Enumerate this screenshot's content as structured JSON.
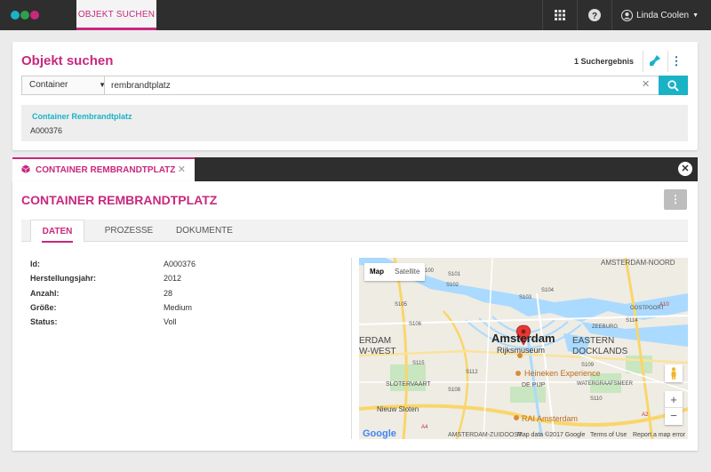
{
  "app": {
    "active_tab": "OBJEKT SUCHEN",
    "user_name": "Linda Coolen",
    "logo_colors": [
      "#1ab3c6",
      "#2f9e4f",
      "#c8287e"
    ]
  },
  "search": {
    "title": "Objekt suchen",
    "results_count": "1 Suchergebnis",
    "type_select": "Container",
    "query": "rembrandtplatz",
    "result": {
      "title": "Container Rembrandtplatz",
      "id": "A000376"
    }
  },
  "detail": {
    "tab_label": "CONTAINER REMBRANDTPLATZ",
    "heading": "CONTAINER REMBRANDTPLATZ",
    "tabs": [
      "DATEN",
      "PROZESSE",
      "DOKUMENTE"
    ],
    "active_tab_index": 0,
    "properties": [
      {
        "label": "Id:",
        "value": "A000376"
      },
      {
        "label": "Herstellungsjahr:",
        "value": "2012"
      },
      {
        "label": "Anzahl:",
        "value": "28"
      },
      {
        "label": "Größe:",
        "value": "Medium"
      },
      {
        "label": "Status:",
        "value": "Voll"
      }
    ]
  },
  "map": {
    "type_buttons": [
      "Map",
      "Satellite"
    ],
    "labels": {
      "city": "Amsterdam",
      "rijksmuseum": "Rijksmuseum",
      "heineken": "Heineken Experience",
      "rai": "RAI Amsterdam",
      "eastern_docklands_1": "EASTERN",
      "eastern_docklands_2": "DOCKLANDS",
      "erdam": "ERDAM",
      "west": "W-WEST",
      "sloten": "Nieuw Sloten",
      "sloterv": "SLOTERVAART",
      "de_pijp": "DE PIJP",
      "amsterdam_noord": "AMSTERDAM-NOORD",
      "oostpoort": "OOSTPOORT",
      "zeeburg": "ZEEBURG",
      "oosterwold": "WATERGRAAFSMEER",
      "amsterdam_zuid": "AMSTERDAM-ZUIDOOST"
    },
    "road_labels": [
      "S100",
      "S101",
      "S102",
      "S103",
      "S104",
      "S105",
      "S106",
      "S108",
      "S109",
      "S110",
      "S112",
      "S114",
      "S115",
      "A10",
      "A4",
      "A2"
    ],
    "zoom_in": "+",
    "zoom_out": "−",
    "google": "Google",
    "map_data": "Map data ©2017 Google",
    "terms": "Terms of Use",
    "report": "Report a map error"
  }
}
